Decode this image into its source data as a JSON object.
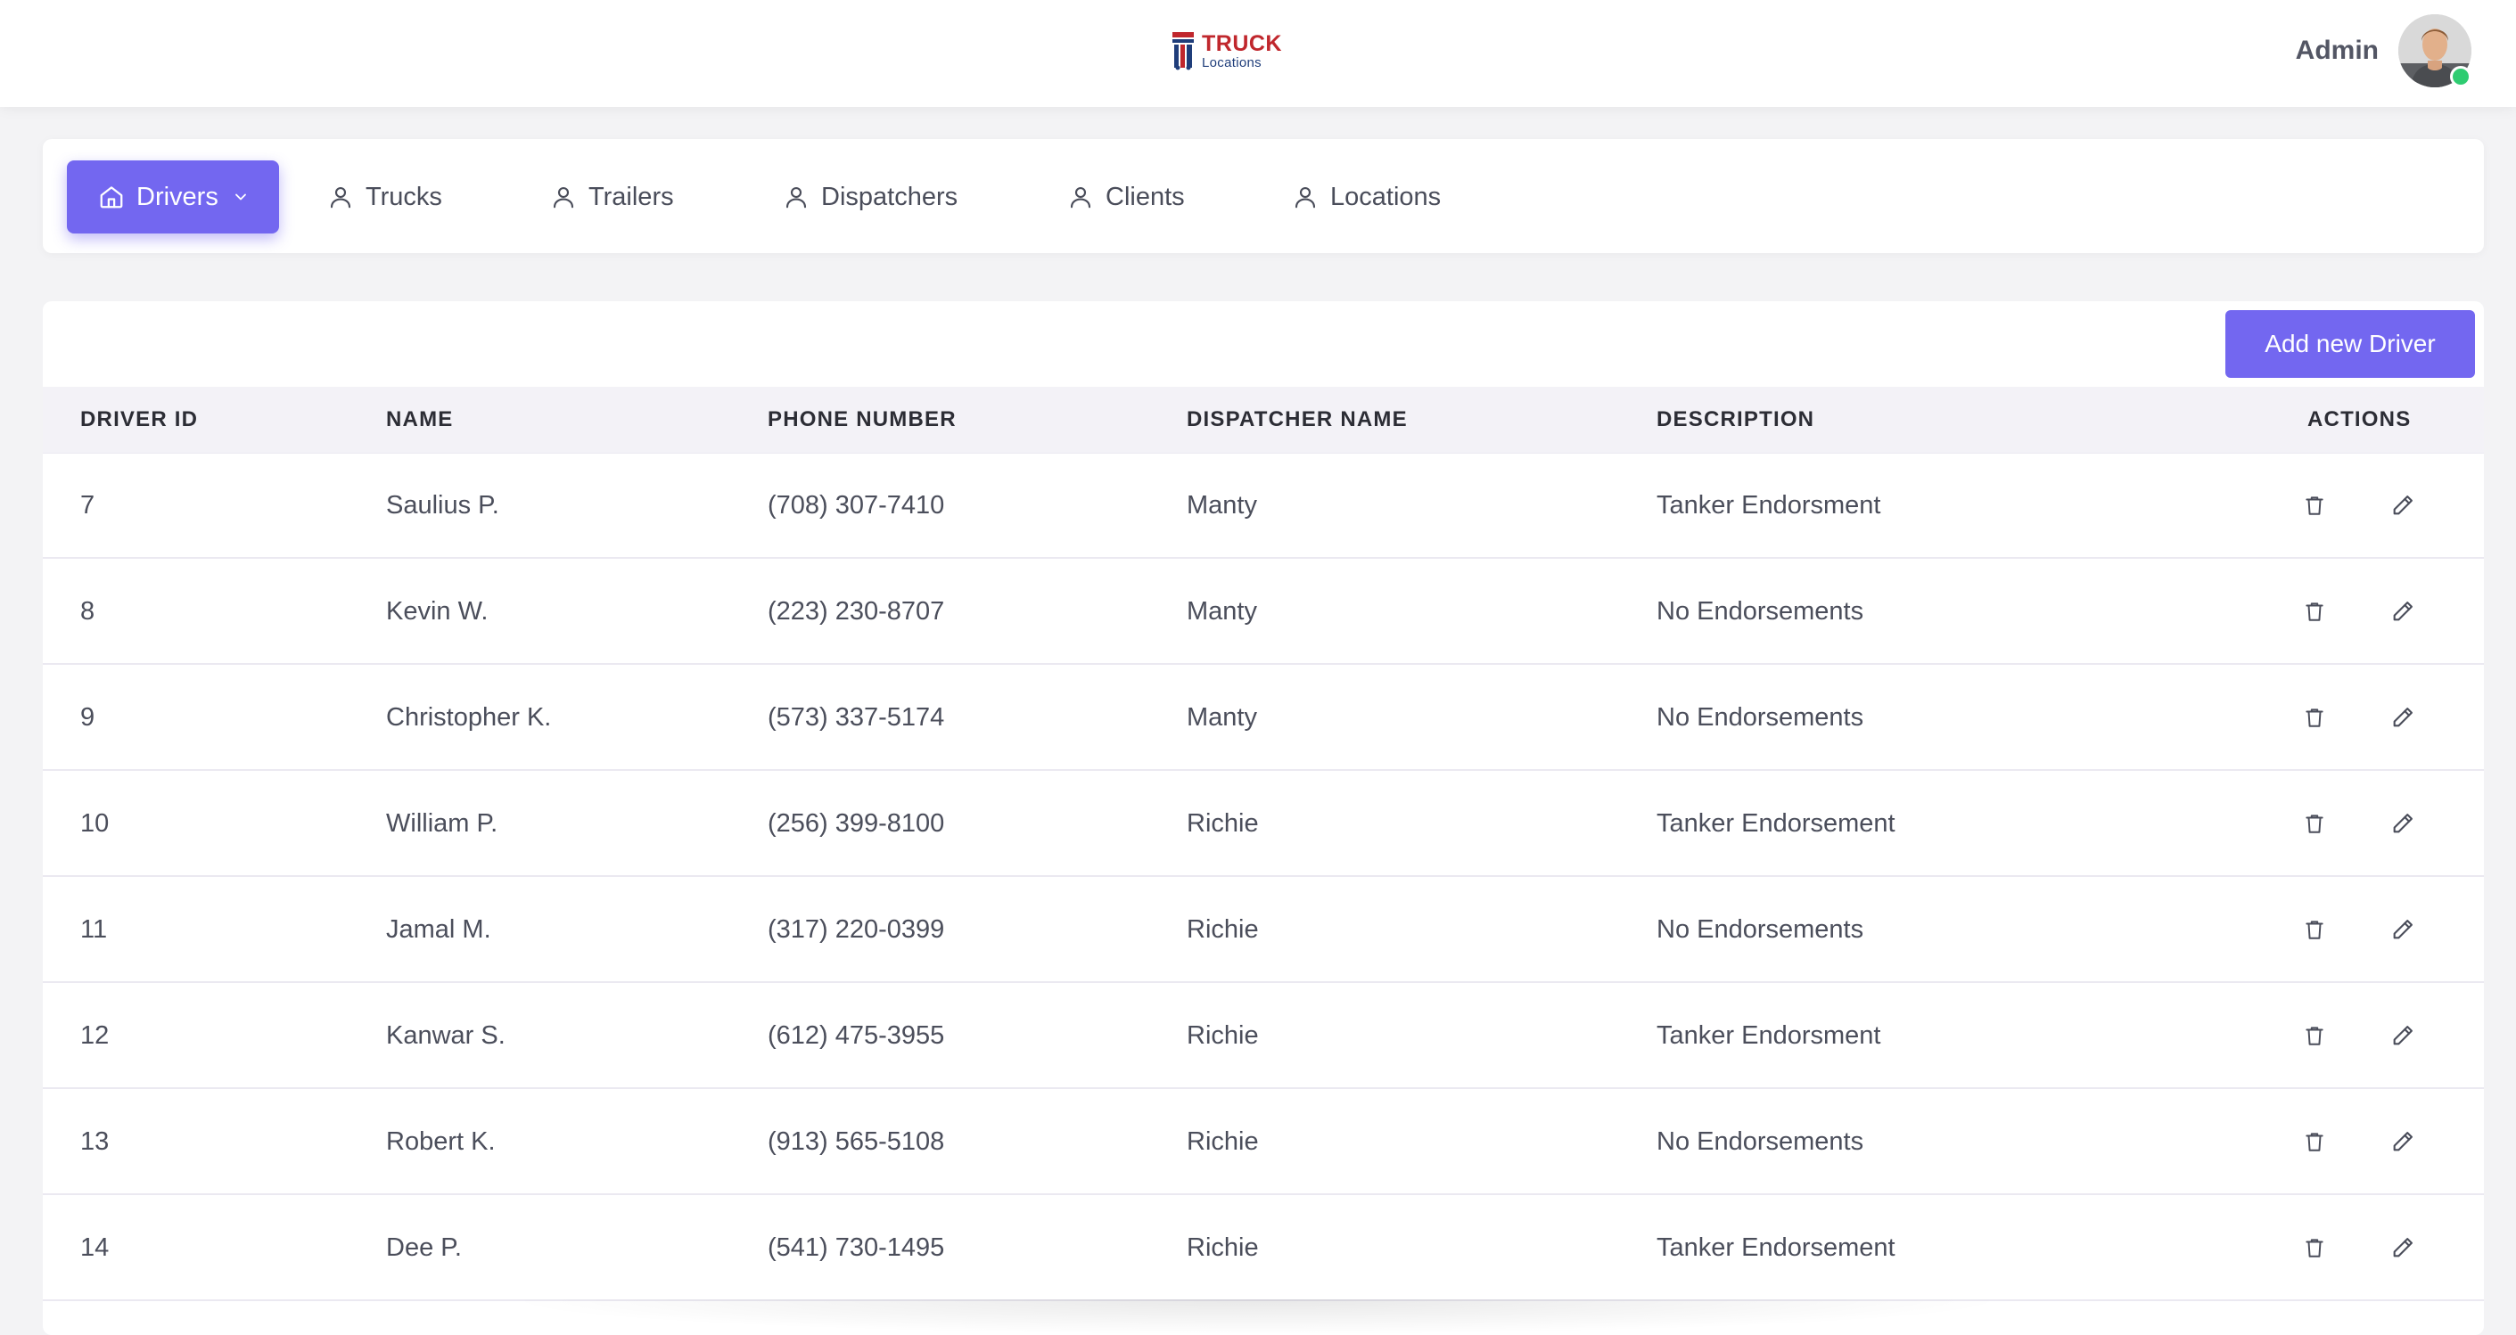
{
  "header": {
    "logo_title": "TRUCK",
    "logo_subtitle": "Locations",
    "user_name": "Admin",
    "status_color": "#2ecc71"
  },
  "nav": {
    "items": [
      {
        "label": "Drivers",
        "icon": "home-icon",
        "active": true,
        "has_dropdown": true
      },
      {
        "label": "Trucks",
        "icon": "user-icon"
      },
      {
        "label": "Trailers",
        "icon": "user-icon"
      },
      {
        "label": "Dispatchers",
        "icon": "user-icon"
      },
      {
        "label": "Clients",
        "icon": "user-icon"
      },
      {
        "label": "Locations",
        "icon": "user-icon"
      }
    ]
  },
  "table": {
    "add_button_label": "Add new Driver",
    "columns": [
      "DRIVER ID",
      "NAME",
      "PHONE NUMBER",
      "DISPATCHER NAME",
      "DESCRIPTION",
      "ACTIONS"
    ],
    "rows": [
      {
        "id": "7",
        "name": "Saulius P.",
        "phone": "(708) 307-7410",
        "dispatcher": "Manty",
        "description": "Tanker Endorsment"
      },
      {
        "id": "8",
        "name": "Kevin W.",
        "phone": "(223) 230-8707",
        "dispatcher": "Manty",
        "description": "No Endorsements"
      },
      {
        "id": "9",
        "name": "Christopher K.",
        "phone": "(573) 337-5174",
        "dispatcher": "Manty",
        "description": "No Endorsements"
      },
      {
        "id": "10",
        "name": "William P.",
        "phone": "(256) 399-8100",
        "dispatcher": "Richie",
        "description": "Tanker Endorsement"
      },
      {
        "id": "11",
        "name": "Jamal M.",
        "phone": "(317) 220-0399",
        "dispatcher": "Richie",
        "description": "No Endorsements"
      },
      {
        "id": "12",
        "name": "Kanwar S.",
        "phone": "(612) 475-3955",
        "dispatcher": "Richie",
        "description": "Tanker Endorsment"
      },
      {
        "id": "13",
        "name": "Robert K.",
        "phone": "(913) 565-5108",
        "dispatcher": "Richie",
        "description": "No Endorsements"
      },
      {
        "id": "14",
        "name": "Dee P.",
        "phone": "(541) 730-1495",
        "dispatcher": "Richie",
        "description": "Tanker Endorsement"
      }
    ],
    "row_actions": [
      "trash-icon",
      "pencil-icon"
    ]
  },
  "colors": {
    "accent": "#7367f0",
    "header_bg": "#ffffff",
    "page_bg": "#f3f3f5",
    "table_head_bg": "#f3f2f7",
    "logo_red": "#c0272d",
    "logo_blue": "#1f3d7a"
  }
}
